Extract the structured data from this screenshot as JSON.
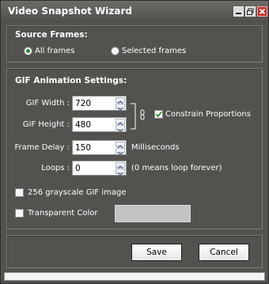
{
  "window": {
    "title": "Video Snapshot Wizard"
  },
  "source_frames": {
    "title": "Source Frames:",
    "options": [
      {
        "label": "All frames",
        "selected": true
      },
      {
        "label": "Selected frames",
        "selected": false
      }
    ]
  },
  "gif_settings": {
    "title": "GIF Animation Settings:",
    "width_label": "GIF Width :",
    "width_value": "720",
    "height_label": "GIF Height :",
    "height_value": "480",
    "constrain_label": "Constrain Proportions",
    "constrain_checked": true,
    "delay_label": "Frame Delay :",
    "delay_value": "150",
    "delay_unit": "Milliseconds",
    "loops_label": "Loops :",
    "loops_value": "0",
    "loops_hint": "(0 means loop forever)",
    "grayscale_label": "256 grayscale GIF image",
    "grayscale_checked": false,
    "transparent_label": "Transparent Color",
    "transparent_checked": false,
    "transparent_color": "#c3c3c3"
  },
  "buttons": {
    "save": "Save",
    "cancel": "Cancel"
  }
}
